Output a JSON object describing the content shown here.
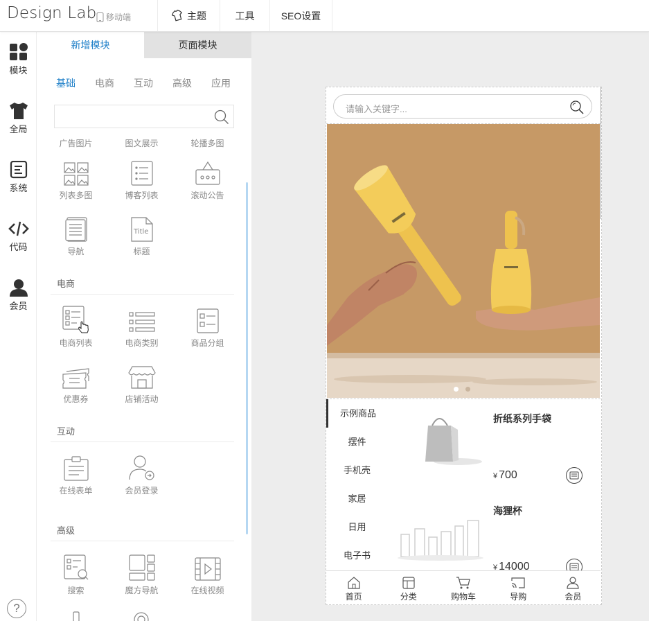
{
  "header": {
    "logo": "Design Lab",
    "mobile_mode": "移动端",
    "menu": {
      "theme": "主题",
      "tools": "工具",
      "seo": "SEO设置"
    }
  },
  "rail": {
    "items": [
      {
        "label": "模块",
        "icon": "modules-icon"
      },
      {
        "label": "全局",
        "icon": "shirt-icon"
      },
      {
        "label": "系统",
        "icon": "system-icon"
      },
      {
        "label": "代码",
        "icon": "code-icon"
      },
      {
        "label": "会员",
        "icon": "user-icon"
      }
    ],
    "help": "?"
  },
  "panel": {
    "tabs": {
      "add": "新增模块",
      "page": "页面模块"
    },
    "categories": [
      "基础",
      "电商",
      "互动",
      "高级",
      "应用"
    ],
    "active_category": "基础",
    "top_labels": [
      "广告图片",
      "图文展示",
      "轮播多图"
    ],
    "basic": [
      "列表多图",
      "博客列表",
      "滚动公告",
      "导航",
      "标题"
    ],
    "ecommerce_title": "电商",
    "ecommerce": [
      "电商列表",
      "电商类别",
      "商品分组",
      "优惠券",
      "店铺活动"
    ],
    "interactive_title": "互动",
    "interactive": [
      "在线表单",
      "会员登录"
    ],
    "advanced_title": "高级",
    "advanced": [
      "搜索",
      "魔方导航",
      "在线视频"
    ]
  },
  "phone": {
    "search_placeholder": "请输入关键字...",
    "categories": [
      "示例商品",
      "摆件",
      "手机壳",
      "家居",
      "日用",
      "电子书"
    ],
    "products": [
      {
        "name": "折纸系列手袋",
        "currency": "¥",
        "price": "700"
      },
      {
        "name": "海狸杯",
        "currency": "¥",
        "price": "14000"
      }
    ],
    "nav": [
      "首页",
      "分类",
      "购物车",
      "导购",
      "会员"
    ]
  },
  "colors": {
    "accent": "#1e7fc8",
    "banner": "#c79a69",
    "product_yellow": "#f3cc5a"
  }
}
